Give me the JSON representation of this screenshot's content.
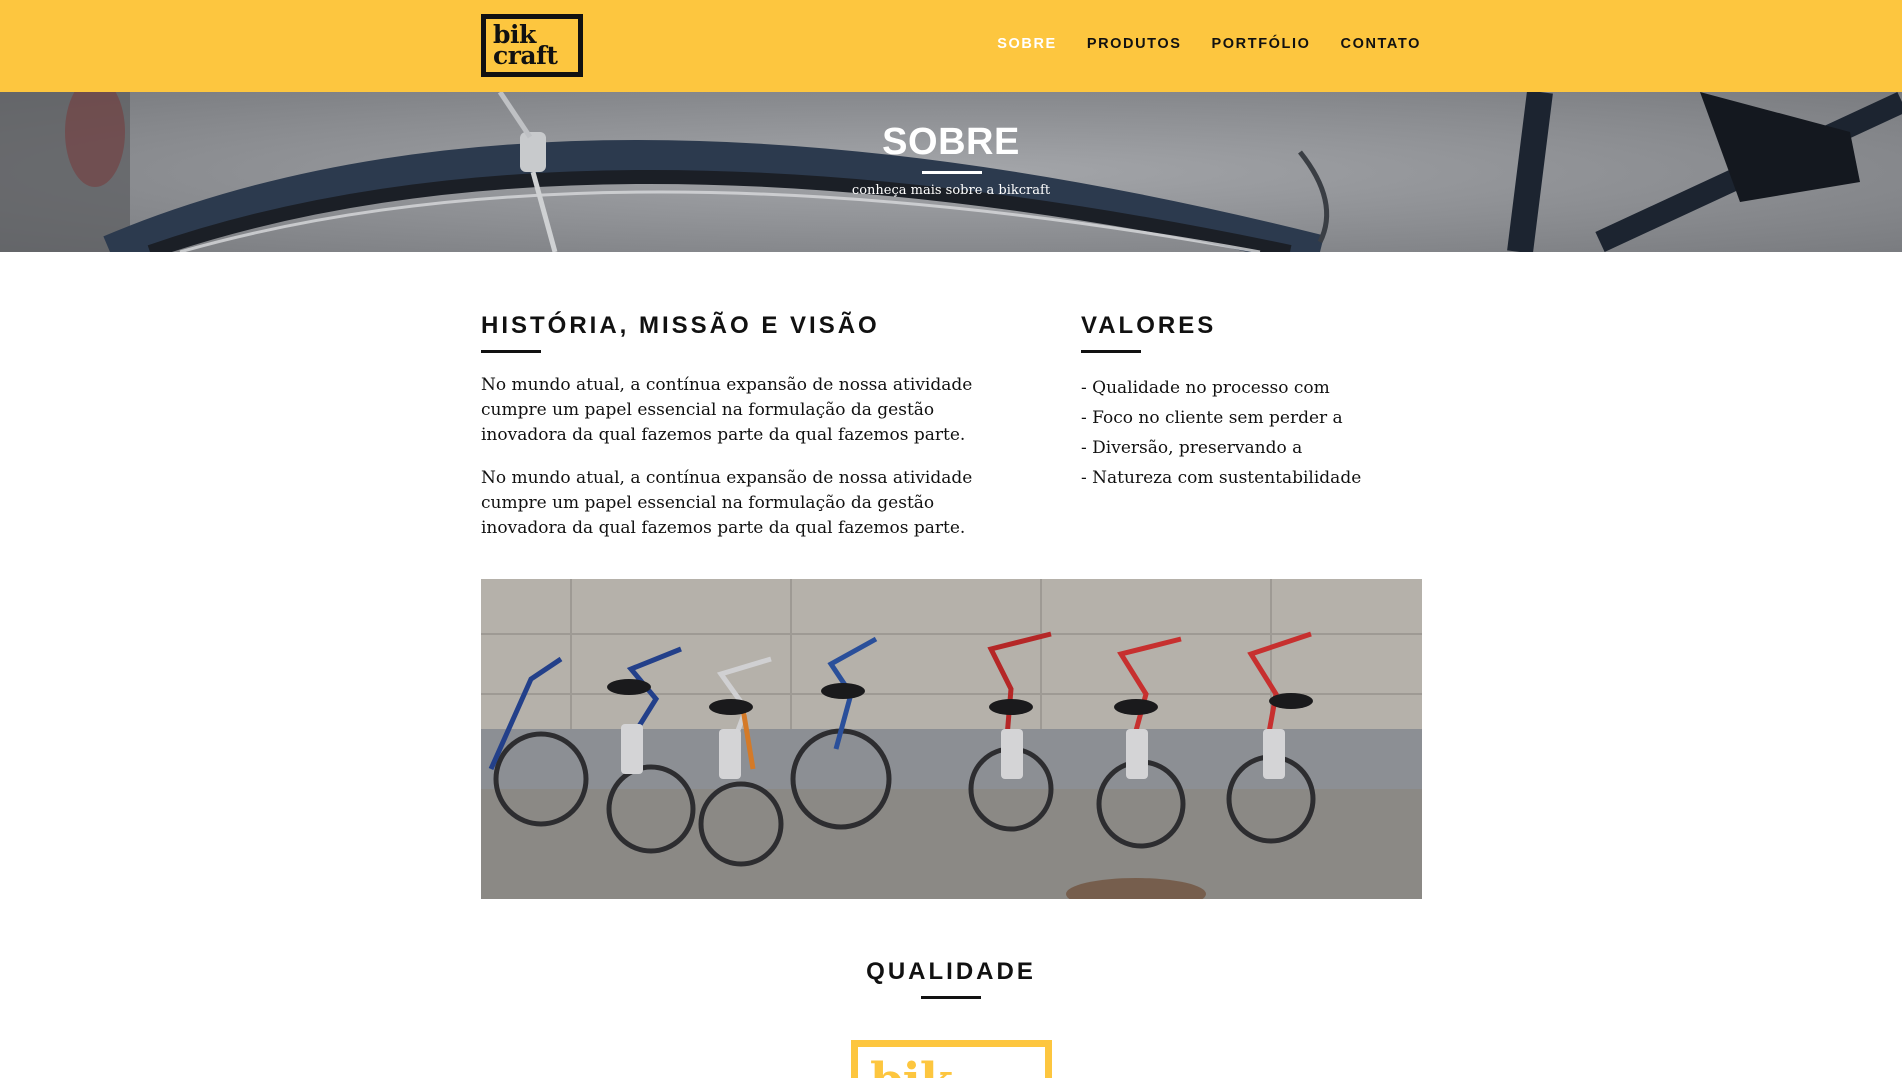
{
  "brand": {
    "logo_line1": "bik",
    "logo_line2": "craft"
  },
  "nav": {
    "items": [
      {
        "label": "SOBRE",
        "active": true
      },
      {
        "label": "PRODUTOS",
        "active": false
      },
      {
        "label": "PORTFÓLIO",
        "active": false
      },
      {
        "label": "CONTATO",
        "active": false
      }
    ]
  },
  "hero": {
    "title": "SOBRE",
    "subtitle": "conheça mais sobre a bikcraft"
  },
  "history": {
    "title": "HISTÓRIA, MISSÃO E VISÃO",
    "paragraphs": [
      "No mundo atual, a contínua expansão de nossa atividade cumpre um papel essencial na formulação da gestão inovadora da qual fazemos parte da qual fazemos parte.",
      "No mundo atual, a contínua expansão de nossa atividade cumpre um papel essencial na formulação da gestão inovadora da qual fazemos parte da qual fazemos parte."
    ]
  },
  "values": {
    "title": "VALORES",
    "items": [
      "- Qualidade no processo com",
      "- Foco no cliente sem perder a",
      "- Diversão, preservando a",
      "- Natureza com sustentabilidade"
    ]
  },
  "quality": {
    "title": "QUALIDADE",
    "logo_text": "bik"
  },
  "colors": {
    "brand_yellow": "#FDC63F",
    "text": "#111111",
    "white": "#ffffff"
  }
}
